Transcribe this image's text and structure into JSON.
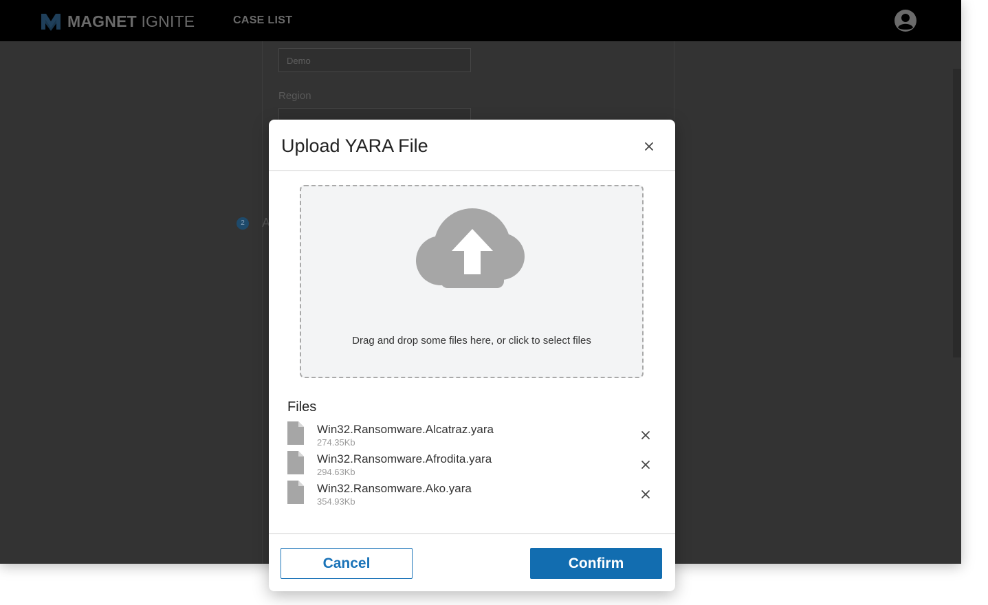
{
  "app": {
    "brand_bold": "MAGNET",
    "brand_light": "IGNITE",
    "nav_case_list": "CASE LIST"
  },
  "background": {
    "case_name_value": "Demo",
    "region_label": "Region",
    "step_number": "2",
    "step_text": "A"
  },
  "modal": {
    "title": "Upload YARA File",
    "dropzone_text": "Drag and drop some files here, or click to select files",
    "files_heading": "Files",
    "files": [
      {
        "name": "Win32.Ransomware.Alcatraz.yara",
        "size": "274.35Kb"
      },
      {
        "name": "Win32.Ransomware.Afrodita.yara",
        "size": "294.63Kb"
      },
      {
        "name": "Win32.Ransomware.Ako.yara",
        "size": "354.93Kb"
      }
    ],
    "cancel_label": "Cancel",
    "confirm_label": "Confirm"
  },
  "colors": {
    "topbar": "#000000",
    "overlay": "#333333",
    "primary": "#126db0",
    "dropzone_bg": "#f3f4f5",
    "icon_gray": "#a6a6a6"
  },
  "icons": {
    "logo": "magnet-logo-icon",
    "user": "user-avatar-icon",
    "close": "close-icon",
    "upload": "cloud-upload-icon",
    "file": "file-icon",
    "remove": "close-icon"
  }
}
